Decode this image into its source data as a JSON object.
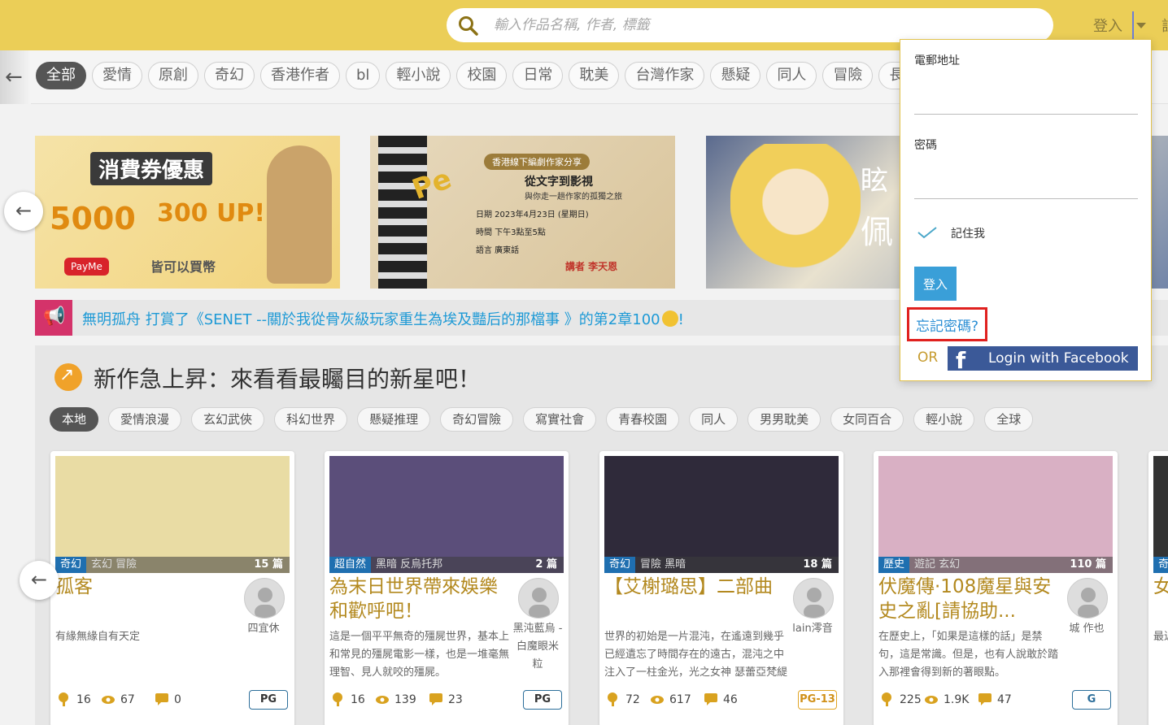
{
  "header": {
    "search_placeholder": "輸入作品名稱, 作者, 標籤",
    "login_label": "登入",
    "edge_text": "註"
  },
  "tags": [
    "全部",
    "愛情",
    "原創",
    "奇幻",
    "香港作者",
    "bl",
    "輕小說",
    "校園",
    "日常",
    "耽美",
    "台灣作家",
    "懸疑",
    "同人",
    "冒險",
    "長篇"
  ],
  "banners": {
    "b1": {
      "title": "消費券優惠",
      "amount": "5000",
      "bonus": "300 UP!",
      "payme": "PayMe",
      "note": "皆可以買幣"
    },
    "b2": {
      "tagline": "香港線下編劇作家分享",
      "topic": "從文字到影視",
      "subtitle": "與你走一趟作家的孤獨之旅",
      "date": "日期 2023年4月23日 (星期日)",
      "time": "時間 下午3點至5點",
      "lang": "語言 廣東話",
      "speaker": "講者 李天恩"
    },
    "b3": {
      "text1": "眩",
      "text2": "佩"
    }
  },
  "notice": {
    "text": "無明孤舟 打賞了《SENET --關於我從骨灰級玩家重生為埃及豔后的那檔事 》的第2章100",
    "suffix": "!"
  },
  "section": {
    "title": "新作急上昇：來看看最矚目的新星吧！",
    "subtags": [
      "本地",
      "愛情浪漫",
      "玄幻武俠",
      "科幻世界",
      "懸疑推理",
      "奇幻冒險",
      "寫實社會",
      "青春校園",
      "同人",
      "男男耽美",
      "女同百合",
      "輕小說",
      "全球"
    ]
  },
  "cards": [
    {
      "genre": "奇幻",
      "sub": "玄幻  冒險",
      "count": "15 篇",
      "title": "孤客",
      "desc": "有緣無緣自有天定",
      "author": "四宜休",
      "likes": "16",
      "views": "67",
      "comments": "0",
      "rating": "PG",
      "cover_color": "#e9dca4"
    },
    {
      "genre": "超自然",
      "sub": "黑暗  反烏托邦",
      "count": "2 篇",
      "title": "為末日世界帶來娛樂和歡呼吧！",
      "desc": "這是一個平平無奇的殭屍世界，基本上和常見的殭屍電影一樣，也是一堆毫無理智、見人就咬的殭屍。",
      "author": "黑沌藍烏 - 白魔眼米粒",
      "likes": "16",
      "views": "139",
      "comments": "23",
      "rating": "PG",
      "cover_color": "#5b4e7a"
    },
    {
      "genre": "奇幻",
      "sub": "冒險  黑暗",
      "count": "18 篇",
      "title": "【艾榭璐思】二部曲",
      "desc": "世界的初始是一片混沌，在遙遠到幾乎已經遺忘了時間存在的遠古，混沌之中注入了一柱金光，光之女神 瑟蕾亞梵緹思為這個世界帶來",
      "author": "lain澪音",
      "likes": "72",
      "views": "617",
      "comments": "46",
      "rating": "PG-13",
      "cover_color": "#2f2a3a"
    },
    {
      "genre": "歷史",
      "sub": "遊記  玄幻",
      "count": "110 篇",
      "title": "伏魔傳·108魔星與安史之亂[請協助...",
      "desc": "在歷史上，「如果是這樣的話」是禁句，這是常識。但是，也有人說敢於踏入那裡會得到新的著眼點。",
      "author": "城  作也",
      "likes": "225",
      "views": "1.9K",
      "comments": "47",
      "rating": "G",
      "cover_color": "#d9b0c4"
    },
    {
      "genre": "奇",
      "title": "女",
      "desc": "最近歡迎一個部"
    }
  ],
  "login": {
    "email_label": "電郵地址",
    "password_label": "密碼",
    "remember_label": "記住我",
    "login_button": "登入",
    "forgot_link": "忘記密碼?",
    "or_label": "OR",
    "facebook_button": "Login with Facebook"
  },
  "colors": {
    "header_bg": "#ebce57",
    "accent_gold": "#b3891f",
    "link_blue": "#1e9ad6",
    "facebook_blue": "#3b5998"
  }
}
